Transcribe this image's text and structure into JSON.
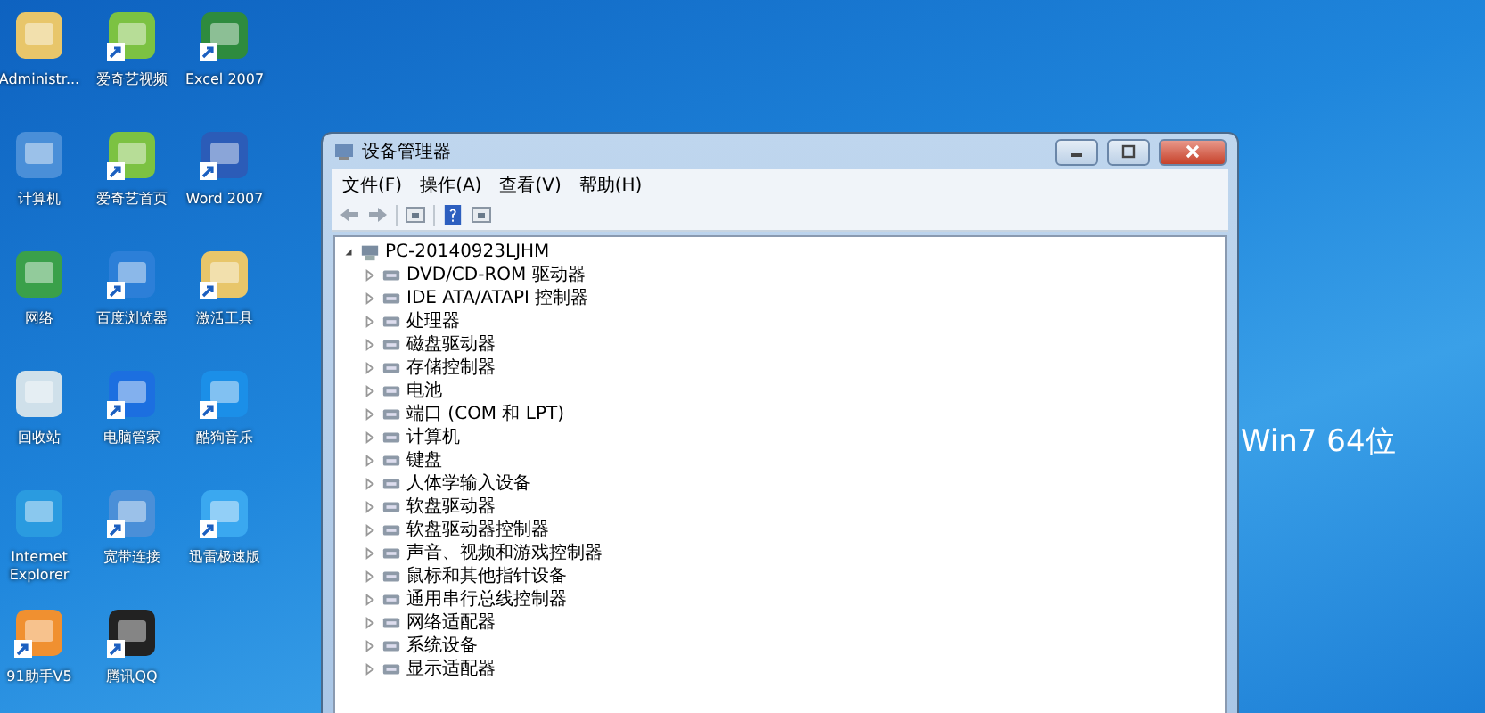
{
  "desktop_icons": [
    {
      "label": "Administr...",
      "kind": "folder",
      "shortcut": false
    },
    {
      "label": "爱奇艺视频",
      "kind": "video",
      "shortcut": true
    },
    {
      "label": "Excel 2007",
      "kind": "excel",
      "shortcut": true
    },
    {
      "label": "计算机",
      "kind": "computer",
      "shortcut": false
    },
    {
      "label": "爱奇艺首页",
      "kind": "video",
      "shortcut": true
    },
    {
      "label": "Word 2007",
      "kind": "word",
      "shortcut": true
    },
    {
      "label": "网络",
      "kind": "network",
      "shortcut": false
    },
    {
      "label": "百度浏览器",
      "kind": "browser",
      "shortcut": true
    },
    {
      "label": "激活工具",
      "kind": "folder",
      "shortcut": true
    },
    {
      "label": "回收站",
      "kind": "recycle",
      "shortcut": false
    },
    {
      "label": "电脑管家",
      "kind": "shield",
      "shortcut": true
    },
    {
      "label": "酷狗音乐",
      "kind": "music",
      "shortcut": true
    },
    {
      "label": "Internet Explorer",
      "kind": "ie",
      "shortcut": false
    },
    {
      "label": "宽带连接",
      "kind": "computer",
      "shortcut": true
    },
    {
      "label": "迅雷极速版",
      "kind": "bird",
      "shortcut": true
    },
    {
      "label": "91助手V5",
      "kind": "helper",
      "shortcut": true
    },
    {
      "label": "腾讯QQ",
      "kind": "penguin",
      "shortcut": true
    }
  ],
  "wallpaper_text": "Win7 64位",
  "window": {
    "title": "设备管理器",
    "menu": [
      "文件(F)",
      "操作(A)",
      "查看(V)",
      "帮助(H)"
    ],
    "tree": {
      "label": "PC-20140923LJHM",
      "expanded": true,
      "children": [
        {
          "label": "DVD/CD-ROM 驱动器",
          "expanded": false
        },
        {
          "label": "IDE ATA/ATAPI 控制器",
          "expanded": false
        },
        {
          "label": "处理器",
          "expanded": false
        },
        {
          "label": "磁盘驱动器",
          "expanded": false
        },
        {
          "label": "存储控制器",
          "expanded": false
        },
        {
          "label": "电池",
          "expanded": false
        },
        {
          "label": "端口 (COM 和 LPT)",
          "expanded": false
        },
        {
          "label": "计算机",
          "expanded": false
        },
        {
          "label": "键盘",
          "expanded": false
        },
        {
          "label": "人体学输入设备",
          "expanded": false
        },
        {
          "label": "软盘驱动器",
          "expanded": false
        },
        {
          "label": "软盘驱动器控制器",
          "expanded": false
        },
        {
          "label": "声音、视频和游戏控制器",
          "expanded": false
        },
        {
          "label": "鼠标和其他指针设备",
          "expanded": false
        },
        {
          "label": "通用串行总线控制器",
          "expanded": false
        },
        {
          "label": "网络适配器",
          "expanded": false
        },
        {
          "label": "系统设备",
          "expanded": false
        },
        {
          "label": "显示适配器",
          "expanded": false
        }
      ]
    }
  }
}
